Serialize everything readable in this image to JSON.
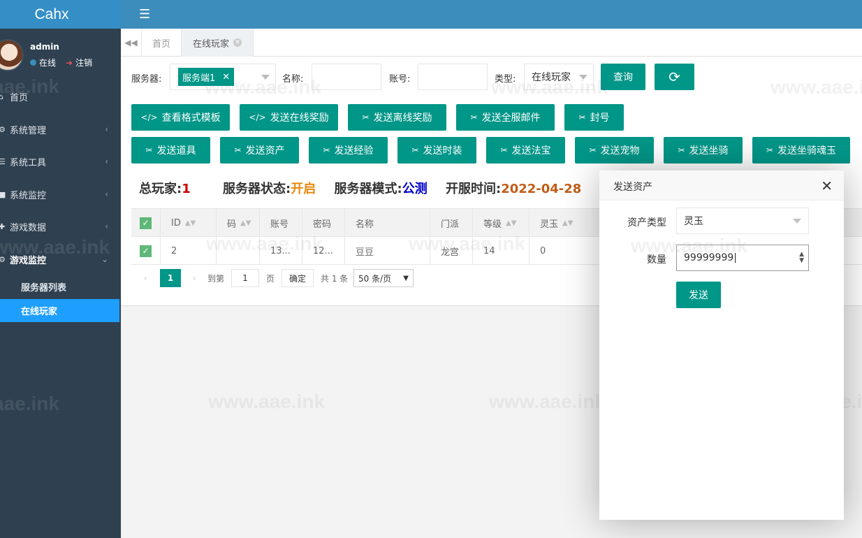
{
  "app": {
    "logo": "Cahx"
  },
  "user": {
    "name": "admin",
    "status": "在线",
    "logout": "注销"
  },
  "sidebar": {
    "items": [
      {
        "label": "首页",
        "icon": "home-icon"
      },
      {
        "label": "系统管理",
        "icon": "gear-icon"
      },
      {
        "label": "系统工具",
        "icon": "bars-icon"
      },
      {
        "label": "系统监控",
        "icon": "video-icon"
      },
      {
        "label": "游戏数据",
        "icon": "puzzle-icon"
      },
      {
        "label": "游戏监控",
        "icon": "gear-icon"
      }
    ],
    "sub_items": [
      {
        "label": "服务器列表"
      },
      {
        "label": "在线玩家"
      }
    ]
  },
  "tabs": [
    {
      "label": "首页"
    },
    {
      "label": "在线玩家"
    }
  ],
  "filters": {
    "server_label": "服务器:",
    "server_chip": "服务端1",
    "name_label": "名称:",
    "account_label": "账号:",
    "type_label": "类型:",
    "type_value": "在线玩家",
    "query_button": "查询"
  },
  "buttons_row1": [
    {
      "label": "查看格式模板",
      "icon": "code-icon"
    },
    {
      "label": "发送在线奖励",
      "icon": "code-icon"
    },
    {
      "label": "发送离线奖励",
      "icon": "tools-icon"
    },
    {
      "label": "发送全服邮件",
      "icon": "tools-icon"
    },
    {
      "label": "封号",
      "icon": "tools-icon"
    }
  ],
  "buttons_row2": [
    {
      "label": "发送道具"
    },
    {
      "label": "发送资产"
    },
    {
      "label": "发送经验"
    },
    {
      "label": "发送时装"
    },
    {
      "label": "发送法宝"
    },
    {
      "label": "发送宠物"
    },
    {
      "label": "发送坐骑"
    },
    {
      "label": "发送坐骑魂玉"
    }
  ],
  "stats": {
    "total_label": "总玩家:",
    "total_value": "1",
    "status_label": "服务器状态:",
    "status_value": "开启",
    "mode_label": "服务器模式:",
    "mode_value": "公测",
    "open_label": "开服时间:",
    "open_value": "2022-04-28",
    "colors": {
      "total": "#cc0000",
      "status": "#e78a0f",
      "mode": "#0000cc",
      "open": "#c25c16"
    }
  },
  "table": {
    "headers": [
      "ID",
      "码",
      "账号",
      "密码",
      "名称",
      "门派",
      "等级",
      "灵玉"
    ],
    "rows": [
      [
        "2",
        "",
        "13...",
        "12...",
        "豆豆",
        "龙宫",
        "14",
        "0"
      ]
    ]
  },
  "pager": {
    "current": "1",
    "goto_label": "到第",
    "goto_value": "1",
    "page_unit": "页",
    "confirm": "确定",
    "total": "共 1 条",
    "page_size": "50 条/页"
  },
  "modal": {
    "title": "发送资产",
    "type_label": "资产类型",
    "type_value": "灵玉",
    "qty_label": "数量",
    "qty_value": "99999999",
    "submit": "发送"
  },
  "watermark": "www.aae.ink",
  "watermark_partial": "aae.ink",
  "colors": {
    "primary": "#009688",
    "topbar": "#3c8dbc",
    "sidebar": "#2f4050",
    "active_nav": "#1e9fff"
  }
}
